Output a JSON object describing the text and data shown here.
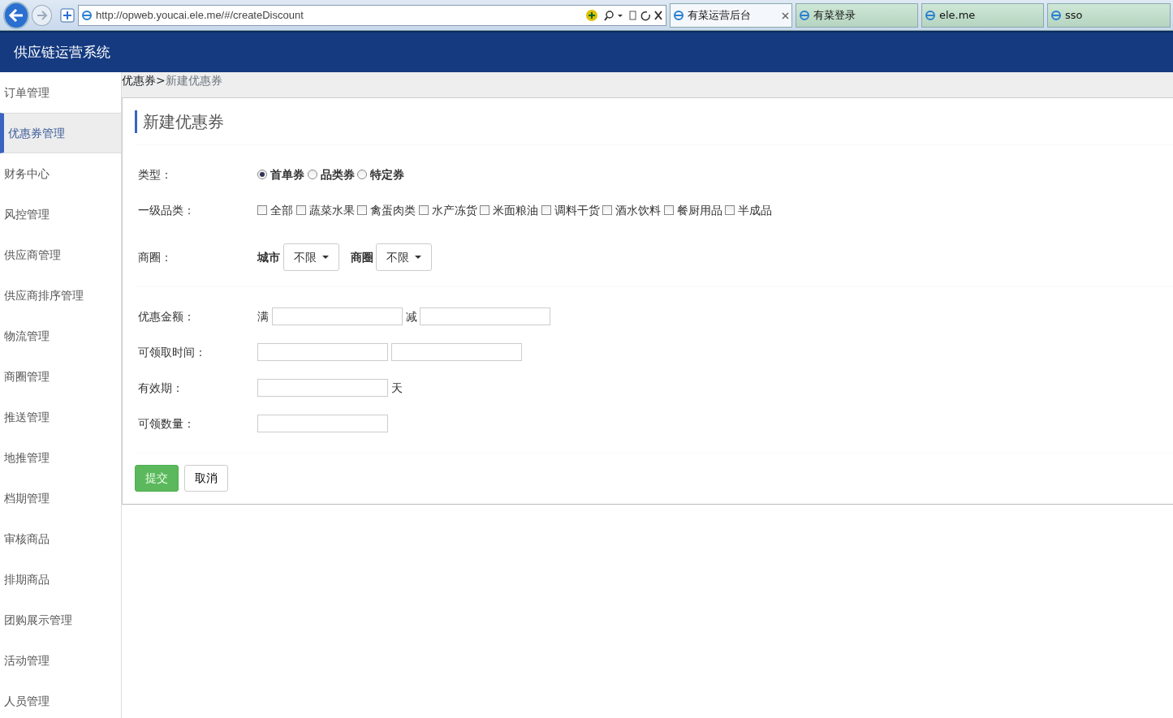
{
  "browser": {
    "address": "http://opweb.youcai.ele.me/#/createDiscount",
    "tabs": [
      {
        "label": "有菜运营后台",
        "selected": true
      },
      {
        "label": "有菜登录",
        "selected": false
      },
      {
        "label": "ele.me",
        "selected": false
      },
      {
        "label": "sso",
        "selected": false
      }
    ]
  },
  "app": {
    "title": "供应链运营系统"
  },
  "sidebar": {
    "items": [
      {
        "label": "订单管理",
        "selected": false
      },
      {
        "label": "优惠券管理",
        "selected": true
      },
      {
        "label": "财务中心",
        "selected": false
      },
      {
        "label": "风控管理",
        "selected": false
      },
      {
        "label": "供应商管理",
        "selected": false
      },
      {
        "label": "供应商排序管理",
        "selected": false
      },
      {
        "label": "物流管理",
        "selected": false
      },
      {
        "label": "商圈管理",
        "selected": false
      },
      {
        "label": "推送管理",
        "selected": false
      },
      {
        "label": "地推管理",
        "selected": false
      },
      {
        "label": "档期管理",
        "selected": false
      },
      {
        "label": "审核商品",
        "selected": false
      },
      {
        "label": "排期商品",
        "selected": false
      },
      {
        "label": "团购展示管理",
        "selected": false
      },
      {
        "label": "活动管理",
        "selected": false
      },
      {
        "label": "人员管理",
        "selected": false
      }
    ]
  },
  "breadcrumb": {
    "parent": "优惠券",
    "separator": ">",
    "current": "新建优惠券"
  },
  "form": {
    "title": "新建优惠券",
    "sections": [
      [
        {
          "kind": "radio",
          "label": "类型：",
          "options": [
            {
              "label": "首单券",
              "selected": true
            },
            {
              "label": "品类券",
              "selected": false
            },
            {
              "label": "特定券",
              "selected": false
            }
          ]
        },
        {
          "kind": "checkbox",
          "label": "一级品类：",
          "options": [
            {
              "label": "全部",
              "checked": false
            },
            {
              "label": "蔬菜水果",
              "checked": false
            },
            {
              "label": "禽蛋肉类",
              "checked": false
            },
            {
              "label": "水产冻货",
              "checked": false
            },
            {
              "label": "米面粮油",
              "checked": false
            },
            {
              "label": "调料干货",
              "checked": false
            },
            {
              "label": "酒水饮料",
              "checked": false
            },
            {
              "label": "餐厨用品",
              "checked": false
            },
            {
              "label": "半成品",
              "checked": false
            }
          ]
        },
        {
          "kind": "select",
          "label": "商圈：",
          "selects": [
            {
              "label": "城市",
              "value": "不限"
            },
            {
              "label": "商圈",
              "value": "不限"
            }
          ]
        }
      ],
      [
        {
          "kind": "fields",
          "label": "优惠金额：",
          "fields": [
            {
              "kind": "input",
              "prefix": "满"
            },
            {
              "kind": "input",
              "prefix": "减"
            }
          ]
        },
        {
          "kind": "fields",
          "label": "可领取时间：",
          "fields": [
            {
              "kind": "input"
            },
            {
              "kind": "input"
            }
          ]
        },
        {
          "kind": "fields",
          "label": "有效期：",
          "fields": [
            {
              "kind": "input",
              "suffix": "天"
            }
          ]
        },
        {
          "kind": "fields",
          "label": "可领数量：",
          "fields": [
            {
              "kind": "input"
            }
          ]
        }
      ]
    ],
    "buttons": [
      {
        "label": "提交",
        "kind": "primary"
      },
      {
        "label": "取消",
        "kind": "default"
      }
    ]
  }
}
